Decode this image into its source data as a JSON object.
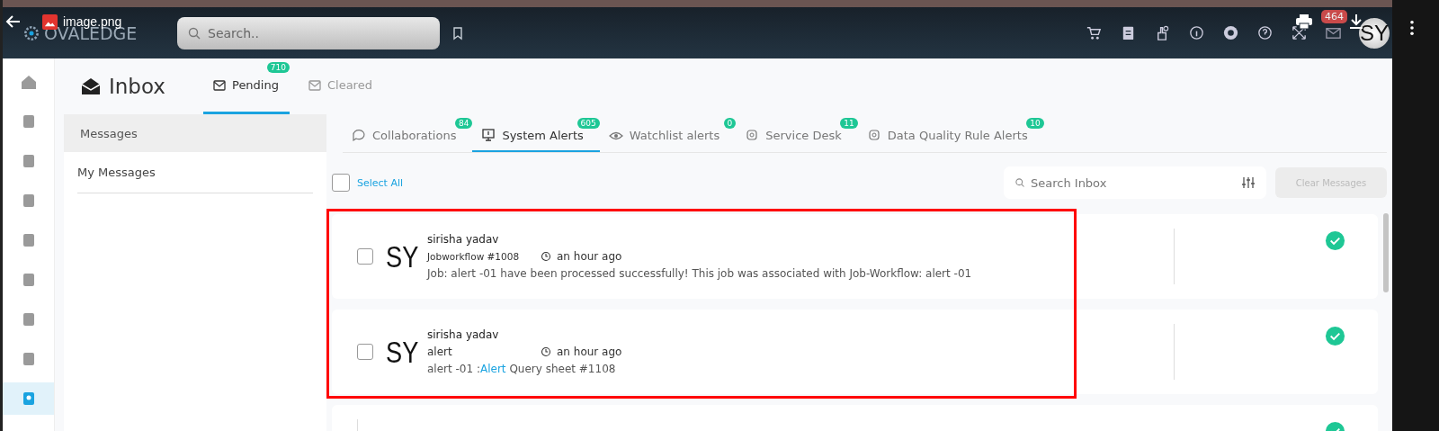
{
  "viewer": {
    "filename": "image.png"
  },
  "header": {
    "logo": "OVALEDGE",
    "search": {
      "placeholder": "Search.."
    },
    "notification_count": "464",
    "avatar": "SY"
  },
  "rail": [
    {
      "selected": false
    },
    {
      "selected": false
    },
    {
      "selected": false
    },
    {
      "selected": false
    },
    {
      "selected": false
    },
    {
      "selected": false
    },
    {
      "selected": false
    },
    {
      "selected": false
    },
    {
      "selected": true
    }
  ],
  "inbox": {
    "title": "Inbox",
    "tabs": [
      {
        "label": "Pending",
        "badge": "710",
        "selected": true
      },
      {
        "label": "Cleared",
        "selected": false
      }
    ]
  },
  "sidebar": {
    "header": "Messages",
    "items": [
      "My Messages"
    ]
  },
  "category_tabs": [
    {
      "label": "Collaborations",
      "badge": "84",
      "selected": false
    },
    {
      "label": "System Alerts",
      "badge": "605",
      "selected": true
    },
    {
      "label": "Watchlist alerts",
      "badge": "0",
      "selected": false
    },
    {
      "label": "Service Desk",
      "badge": "11",
      "selected": false
    },
    {
      "label": "Data Quality Rule Alerts",
      "badge": "10",
      "selected": false
    }
  ],
  "toolbar": {
    "select_all": {
      "label": "Select All",
      "checked": false
    },
    "search": {
      "placeholder": "Search Inbox"
    },
    "clear_button": {
      "label": "Clear Messages",
      "disabled": true
    }
  },
  "messages": [
    {
      "sender": "sirisha yadav",
      "avatar": "SY",
      "subject": "Jobworkflow #1008",
      "time": "an hour ago",
      "body": [
        {
          "kind": "text",
          "text": "Job: alert -01 have been processed successfully! This job was associated with Job-Workflow: alert -01"
        }
      ],
      "checked": false,
      "resolved": true
    },
    {
      "sender": "sirisha yadav",
      "avatar": "SY",
      "subject": "alert",
      "time": "an hour ago",
      "body": [
        {
          "kind": "text",
          "text": "alert -01 :"
        },
        {
          "kind": "link",
          "text": "Alert"
        },
        {
          "kind": "text",
          "text": " Query sheet #1108"
        }
      ],
      "checked": false,
      "resolved": true
    },
    {
      "resolved": true
    }
  ]
}
